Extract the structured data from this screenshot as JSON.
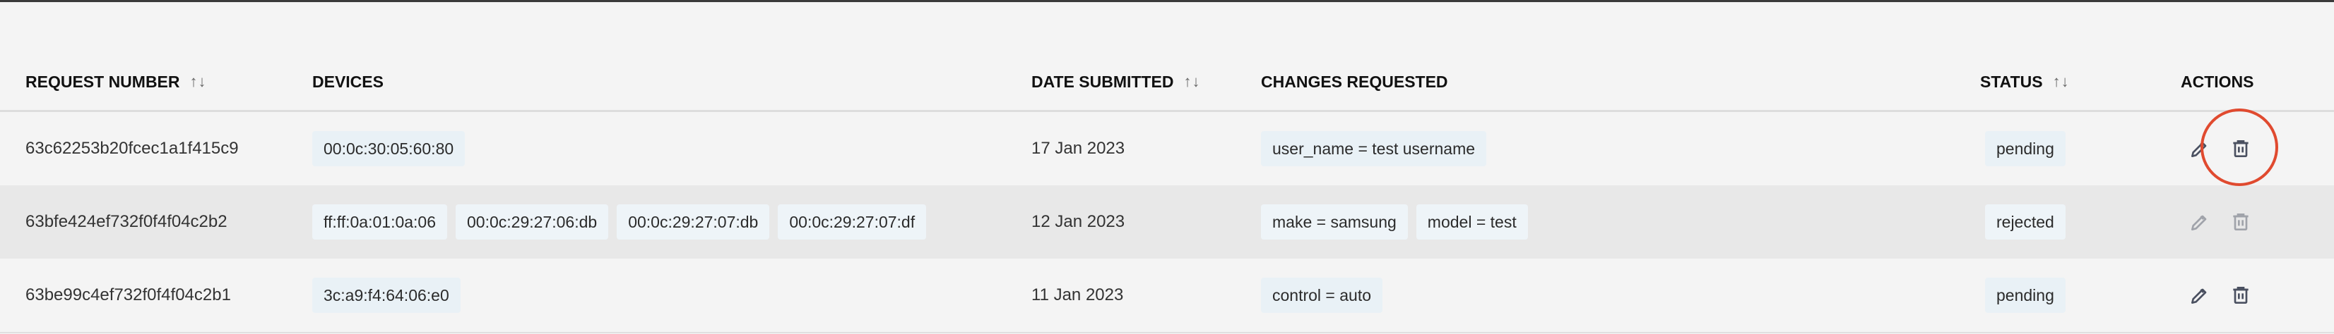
{
  "table": {
    "headers": [
      {
        "label": "REQUEST NUMBER",
        "sortable": true
      },
      {
        "label": "DEVICES",
        "sortable": false
      },
      {
        "label": "DATE SUBMITTED",
        "sortable": true
      },
      {
        "label": "CHANGES REQUESTED",
        "sortable": false
      },
      {
        "label": "STATUS",
        "sortable": true
      },
      {
        "label": "ACTIONS",
        "sortable": false
      }
    ],
    "sort_glyph": "↑↓",
    "rows": [
      {
        "request_number": "63c62253b20fcec1a1f415c9",
        "devices": [
          "00:0c:30:05:60:80"
        ],
        "date_submitted": "17 Jan 2023",
        "changes": [
          "user_name = test username"
        ],
        "status": "pending",
        "actions_enabled": true
      },
      {
        "request_number": "63bfe424ef732f0f4f04c2b2",
        "devices": [
          "ff:ff:0a:01:0a:06",
          "00:0c:29:27:06:db",
          "00:0c:29:27:07:db",
          "00:0c:29:27:07:df"
        ],
        "date_submitted": "12 Jan 2023",
        "changes": [
          "make = samsung",
          "model = test"
        ],
        "status": "rejected",
        "actions_enabled": false
      },
      {
        "request_number": "63be99c4ef732f0f4f04c2b1",
        "devices": [
          "3c:a9:f4:64:06:e0"
        ],
        "date_submitted": "11 Jan 2023",
        "changes": [
          "control = auto"
        ],
        "status": "pending",
        "actions_enabled": true
      }
    ]
  },
  "icons": {
    "edit": "pencil-icon",
    "delete": "trash-icon"
  },
  "colors": {
    "highlight_ring": "#e04a2f",
    "chip_bg": "#e9f1f6",
    "alt_row_bg": "#e8e8e8",
    "icon": "#4a5060"
  }
}
